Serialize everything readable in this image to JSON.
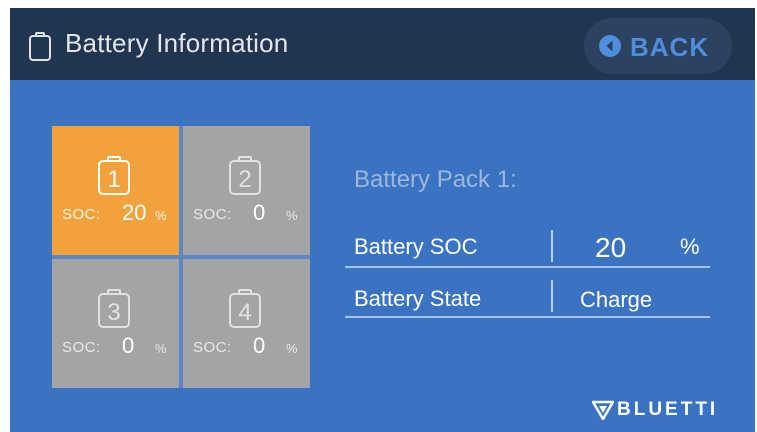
{
  "header": {
    "title": "Battery Information",
    "back_label": "BACK"
  },
  "packs": [
    {
      "number": "1",
      "soc_label": "SOC:",
      "soc_value": "20",
      "unit": "%",
      "selected": true
    },
    {
      "number": "2",
      "soc_label": "SOC:",
      "soc_value": "0",
      "unit": "%",
      "selected": false
    },
    {
      "number": "3",
      "soc_label": "SOC:",
      "soc_value": "0",
      "unit": "%",
      "selected": false
    },
    {
      "number": "4",
      "soc_label": "SOC:",
      "soc_value": "0",
      "unit": "%",
      "selected": false
    }
  ],
  "detail": {
    "title": "Battery Pack 1:",
    "soc_label": "Battery SOC",
    "soc_value": "20",
    "soc_unit": "%",
    "state_label": "Battery State",
    "state_value": "Charge"
  },
  "brand": {
    "name": "BLUETTI"
  },
  "colors": {
    "screen_background": "#3a73c1",
    "header_background": "#213450",
    "selected_tile": "#f2a23c",
    "inactive_tile": "#a2a4a6",
    "back_label": "#4f8edc"
  },
  "icons": {
    "header": "battery-outline-icon",
    "back": "left-arrow-circle-icon",
    "pack": "numbered-battery-icon",
    "brand": "bluetti-logo-mark"
  }
}
